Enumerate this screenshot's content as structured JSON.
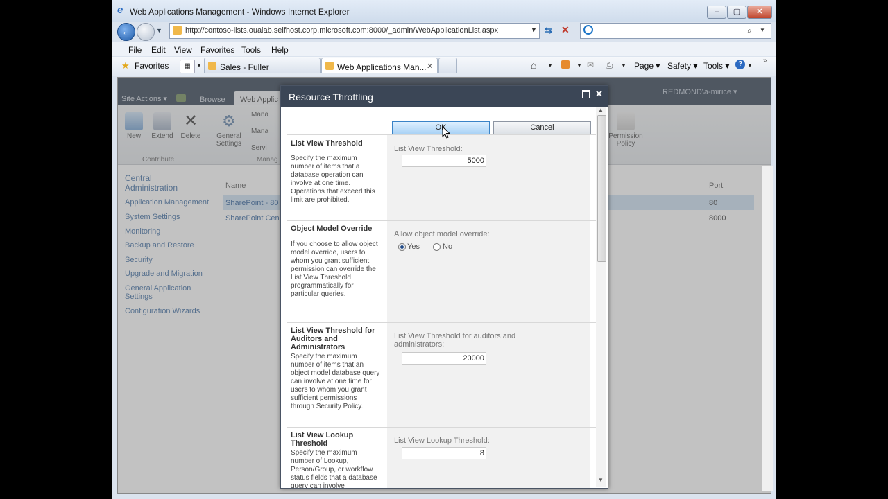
{
  "window": {
    "title": "Web Applications Management - Windows Internet Explorer"
  },
  "address": {
    "url": "http://contoso-lists.oualab.selfhost.corp.microsoft.com:8000/_admin/WebApplicationList.aspx"
  },
  "menu": [
    "File",
    "Edit",
    "View",
    "Favorites",
    "Tools",
    "Help"
  ],
  "favorites": {
    "label": "Favorites"
  },
  "tabs": [
    {
      "label": "Sales - Fuller"
    },
    {
      "label": "Web Applications Man..."
    }
  ],
  "commands": {
    "page": "Page",
    "safety": "Safety",
    "tools": "Tools"
  },
  "sharepoint": {
    "site_actions": "Site Actions",
    "browse": "Browse",
    "web_applications": "Web Applic",
    "user": "REDMOND\\a-mirice",
    "ribbon": {
      "new": "New",
      "extend": "Extend",
      "delete": "Delete",
      "general_settings": "General Settings",
      "contribute": "Contribute",
      "manage_group": "Manag",
      "manage1": "Mana",
      "manage2": "Mana",
      "service": "Servi",
      "permission_policy": "Permission Policy"
    },
    "nav": [
      "Central Administration",
      "Application Management",
      "System Settings",
      "Monitoring",
      "Backup and Restore",
      "Security",
      "Upgrade and Migration",
      "General Application Settings",
      "Configuration Wizards"
    ],
    "table": {
      "col_name": "Name",
      "col_port": "Port",
      "rows": [
        {
          "name": "SharePoint - 80",
          "port": "80"
        },
        {
          "name": "SharePoint Cen",
          "port": "8000"
        }
      ]
    }
  },
  "dialog": {
    "title": "Resource Throttling",
    "ok": "OK",
    "cancel": "Cancel",
    "sections": [
      {
        "title": "List View Threshold",
        "desc": "Specify the maximum number of items that a database operation can involve at one time. Operations that exceed this limit are prohibited.",
        "field_label": "List View Threshold:",
        "value": "5000"
      },
      {
        "title": "Object Model Override",
        "desc": "If you choose to allow object model override, users to whom you grant sufficient permission can override the List View Threshold programmatically for particular queries.",
        "field_label": "Allow object model override:",
        "yes": "Yes",
        "no": "No"
      },
      {
        "title": "List View Threshold for Auditors and Administrators",
        "desc": "Specify the maximum number of items that an object model database query can involve at one time for users to whom you grant sufficient permissions through Security Policy.",
        "field_label": "List View Threshold for auditors and administrators:",
        "value": "20000"
      },
      {
        "title": "List View Lookup Threshold",
        "desc": "Specify the maximum number of Lookup, Person/Group, or workflow status fields that a database query can involve",
        "field_label": "List View Lookup Threshold:",
        "value": "8"
      }
    ]
  }
}
